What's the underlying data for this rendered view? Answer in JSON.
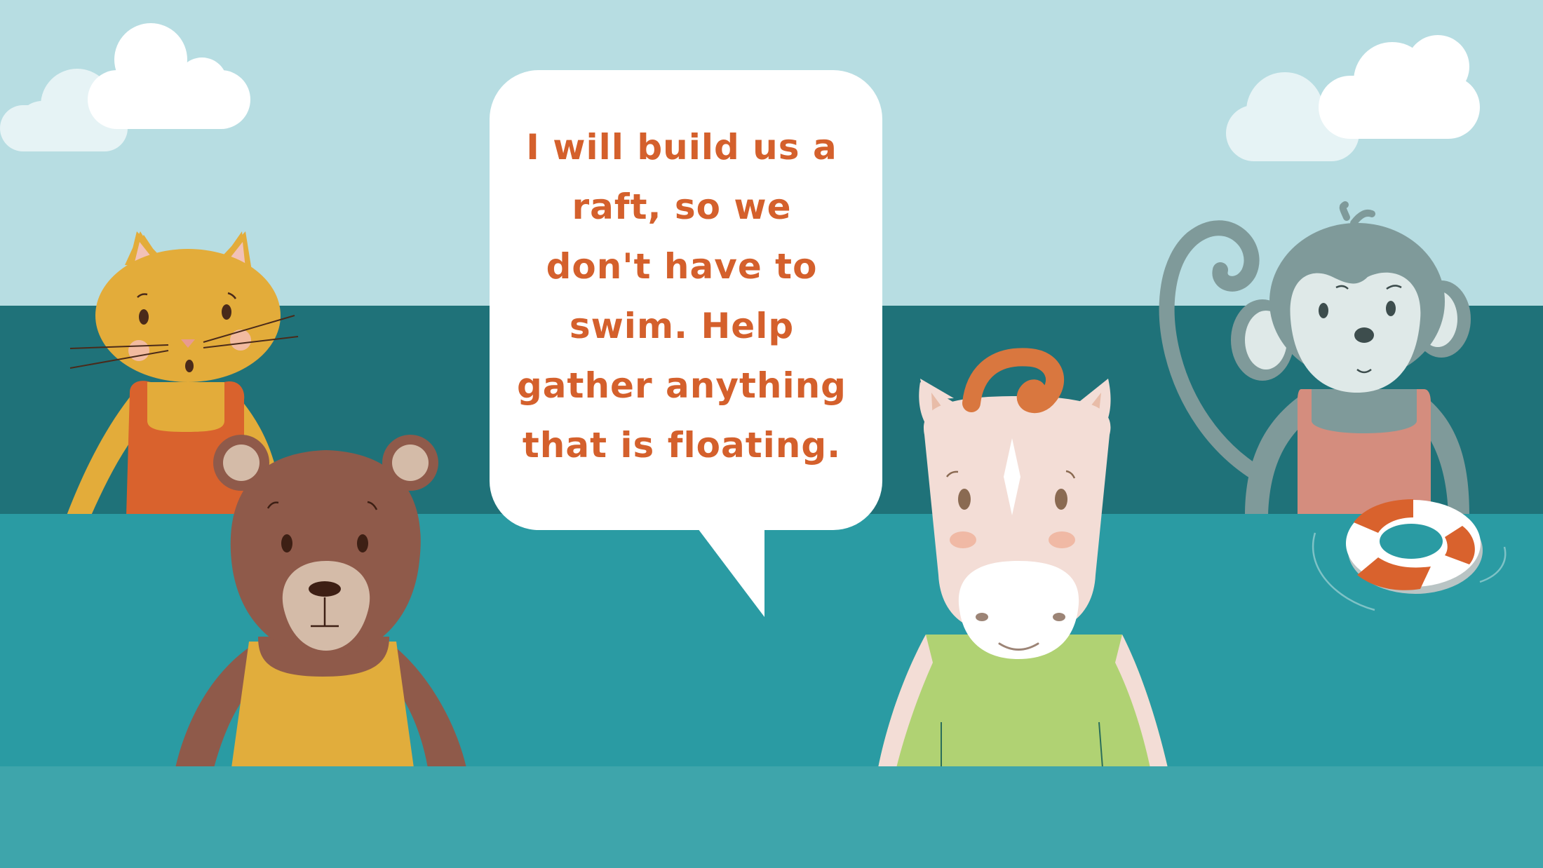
{
  "speech": {
    "lines": [
      "I will build us a",
      "raft, so we",
      "don't have to",
      "swim. Help",
      "gather anything",
      "that is floating."
    ]
  },
  "characters": [
    "cat",
    "bear",
    "horse",
    "monkey"
  ],
  "objects": [
    "life-ring",
    "clouds",
    "speech-bubble"
  ],
  "colors": {
    "sky": "#b7dde2",
    "sea_far": "#1f7279",
    "sea_mid": "#2a9ba3",
    "sea_near": "#3ea5ab",
    "text": "#d4602c"
  }
}
